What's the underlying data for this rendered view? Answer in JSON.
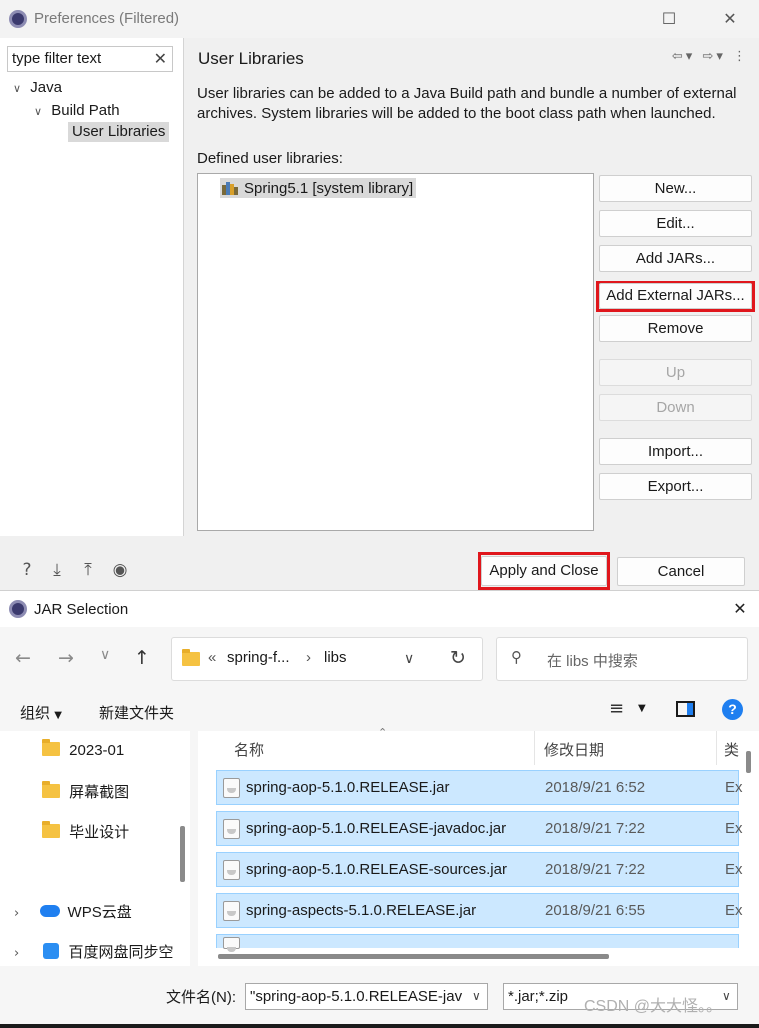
{
  "preferences": {
    "title": "Preferences (Filtered)",
    "filter_value": "type filter text",
    "tree": {
      "java": "Java",
      "build_path": "Build Path",
      "user_libraries": "User Libraries"
    },
    "page_title": "User Libraries",
    "description": "User libraries can be added to a Java Build path and bundle a number of external archives. System libraries will be added to the boot class path when launched.",
    "defined_label": "Defined user libraries:",
    "libraries": [
      {
        "name": "Spring5.1 [system library]"
      }
    ],
    "buttons": {
      "new": "New...",
      "edit": "Edit...",
      "add_jars": "Add JARs...",
      "add_external_jars": "Add External JARs...",
      "remove": "Remove",
      "up": "Up",
      "down": "Down",
      "import": "Import...",
      "export": "Export..."
    },
    "apply_close": "Apply and Close",
    "cancel": "Cancel"
  },
  "jar_dialog": {
    "title": "JAR Selection",
    "breadcrumb": {
      "sep": "«",
      "parent": "spring-f...",
      "arrow": "›",
      "current": "libs"
    },
    "search_placeholder": "在 libs 中搜索",
    "toolbar": {
      "organize": "组织",
      "new_folder": "新建文件夹"
    },
    "nav_items": [
      {
        "label": "2023-01",
        "icon": "folder"
      },
      {
        "label": "屏幕截图",
        "icon": "folder"
      },
      {
        "label": "毕业设计",
        "icon": "folder"
      },
      {
        "label": "WPS云盘",
        "icon": "cloud"
      },
      {
        "label": "百度网盘同步空",
        "icon": "baidu"
      }
    ],
    "columns": {
      "name": "名称",
      "modified": "修改日期",
      "type": "类"
    },
    "files": [
      {
        "name": "spring-aop-5.1.0.RELEASE.jar",
        "date": "2018/9/21 6:52",
        "type": "Ex"
      },
      {
        "name": "spring-aop-5.1.0.RELEASE-javadoc.jar",
        "date": "2018/9/21 7:22",
        "type": "Ex"
      },
      {
        "name": "spring-aop-5.1.0.RELEASE-sources.jar",
        "date": "2018/9/21 7:22",
        "type": "Ex"
      },
      {
        "name": "spring-aspects-5.1.0.RELEASE.jar",
        "date": "2018/9/21 6:55",
        "type": "Ex"
      }
    ],
    "filename_label": "文件名(N):",
    "filename_value": "\"spring-aop-5.1.0.RELEASE-jav",
    "filetype_value": "*.jar;*.zip",
    "watermark": "CSDN @大大怪。。"
  },
  "colors": {
    "highlight": "#e0161c",
    "selection": "#cce8ff",
    "accent": "#1f7ff0"
  }
}
